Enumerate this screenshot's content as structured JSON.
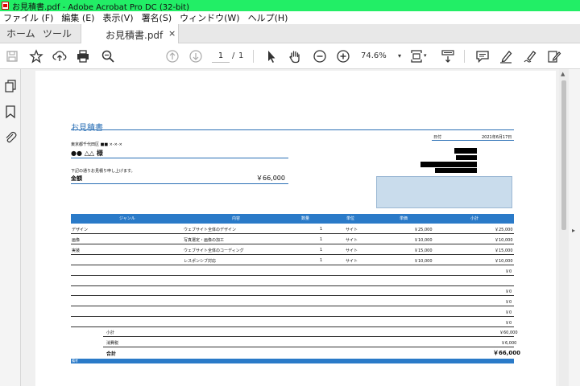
{
  "window": {
    "title": "お見積書.pdf - Adobe Acrobat Pro DC (32-bit)"
  },
  "menu": [
    "ファイル (F)",
    "編集 (E)",
    "表示(V)",
    "署名(S)",
    "ウィンドウ(W)",
    "ヘルプ(H)"
  ],
  "tabs": {
    "home": "ホーム",
    "tools": "ツール",
    "document": "お見積書.pdf",
    "close": "×"
  },
  "toolbar": {
    "page_current": "1",
    "page_separator": "/",
    "page_total": "1",
    "zoom": "74.6%",
    "zoom_caret": "▾",
    "icons": [
      "save-icon",
      "bookmark-star-icon",
      "upload-icon",
      "print-icon",
      "find-icon",
      "prev-page-icon",
      "next-page-icon",
      "select-cursor-icon",
      "hand-tool-icon",
      "zoom-out-icon",
      "zoom-in-icon",
      "fit-page-icon",
      "scroll-mode-icon",
      "comment-icon",
      "highlight-icon",
      "sign-icon",
      "edit-icon"
    ]
  },
  "sidepanel": {
    "icons": [
      "pages-icon",
      "bookmarks-icon",
      "attachments-icon"
    ],
    "left_arrow": "◂",
    "right_arrow": "▸"
  },
  "invoice": {
    "title": "お見積書",
    "address": "東京都千代田区 ■■ ×-×-×",
    "client": "●● △△ 様",
    "greeting": "下記の通りお見積り申し上げます。",
    "amount_label": "金額",
    "amount_value": "￥66,000",
    "date_label": "日付",
    "date_value": "2021年6月17日",
    "headers": [
      "ジャンル",
      "内容",
      "数量",
      "単位",
      "単価",
      "小計"
    ],
    "rows": [
      {
        "genre": "デザイン",
        "content": "ウェブサイト全体のデザイン",
        "qty": "1",
        "unit": "サイト",
        "price": "￥25,000",
        "subtotal": "￥25,000"
      },
      {
        "genre": "画像",
        "content": "写真選定・画像の加工",
        "qty": "1",
        "unit": "サイト",
        "price": "￥10,000",
        "subtotal": "￥10,000"
      },
      {
        "genre": "実装",
        "content": "ウェブサイト全体のコーディング",
        "qty": "1",
        "unit": "サイト",
        "price": "￥15,000",
        "subtotal": "￥15,000"
      },
      {
        "genre": "",
        "content": "レスポンシブ対応",
        "qty": "1",
        "unit": "サイト",
        "price": "￥10,000",
        "subtotal": "￥10,000"
      },
      {
        "genre": "",
        "content": "",
        "qty": "",
        "unit": "",
        "price": "",
        "subtotal": "￥0"
      },
      {
        "genre": "",
        "content": "",
        "qty": "",
        "unit": "",
        "price": "",
        "subtotal": ""
      },
      {
        "genre": "",
        "content": "",
        "qty": "",
        "unit": "",
        "price": "",
        "subtotal": "￥0"
      },
      {
        "genre": "",
        "content": "",
        "qty": "",
        "unit": "",
        "price": "",
        "subtotal": "￥0"
      },
      {
        "genre": "",
        "content": "",
        "qty": "",
        "unit": "",
        "price": "",
        "subtotal": "￥0"
      },
      {
        "genre": "",
        "content": "",
        "qty": "",
        "unit": "",
        "price": "",
        "subtotal": "￥0"
      }
    ],
    "subtotal_label": "小計",
    "subtotal_value": "￥60,000",
    "tax_label": "消費税",
    "tax_value": "￥6,000",
    "total_label": "合計",
    "total_value": "￥66,000",
    "notes_label": "備考"
  },
  "colors": {
    "titlebar": "#22ee66",
    "accent": "#2a7ac8",
    "stamp_box": "#c9dcec"
  }
}
